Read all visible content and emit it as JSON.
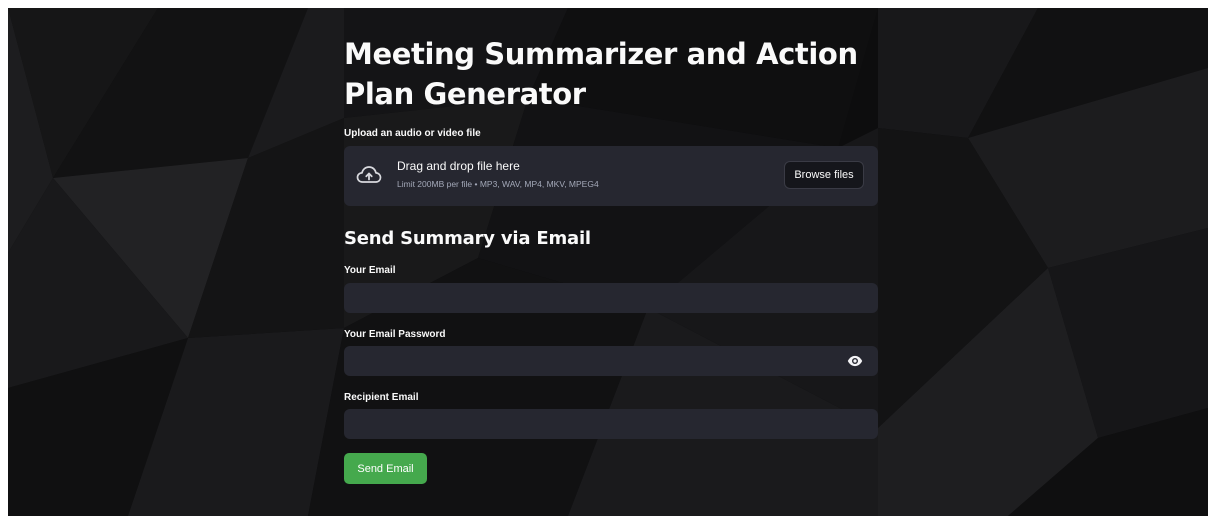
{
  "page": {
    "title": "Meeting Summarizer and Action Plan Generator"
  },
  "uploader": {
    "label": "Upload an audio or video file",
    "drop_text": "Drag and drop file here",
    "limit_text": "Limit 200MB per file • MP3, WAV, MP4, MKV, MPEG4",
    "browse_label": "Browse files",
    "icon": "cloud-upload-icon"
  },
  "email_section": {
    "title": "Send Summary via Email",
    "your_email_label": "Your Email",
    "your_email_value": "",
    "password_label": "Your Email Password",
    "password_value": "",
    "password_toggle_icon": "eye-icon",
    "recipient_label": "Recipient Email",
    "recipient_value": "",
    "send_label": "Send Email"
  },
  "colors": {
    "background": "#0d0d0e",
    "input_background": "#262730",
    "text": "#fafafa",
    "muted_text": "#a3a8b8",
    "send_button": "#45a94d"
  }
}
